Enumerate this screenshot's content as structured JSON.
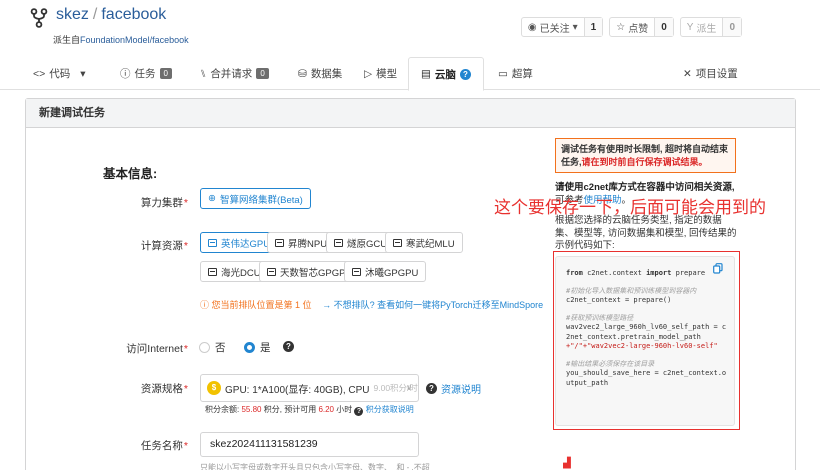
{
  "repo": {
    "owner": "skez",
    "separator": "/",
    "name": "facebook",
    "forked_prefix": "派生自",
    "forked_from": "FoundationModel/facebook",
    "buttons": [
      {
        "label": "已关注",
        "icon": "eye-icon",
        "caret": "▾",
        "count": "1"
      },
      {
        "label": "点赞",
        "icon": "star-icon",
        "count": "0"
      },
      {
        "label": "派生",
        "icon": "fork-icon",
        "count": "0",
        "disabled": true
      }
    ]
  },
  "tabs": [
    {
      "label": "代码",
      "icon": "code-icon",
      "caret": "▾"
    },
    {
      "label": "任务",
      "icon": "issue-icon",
      "badge": "0"
    },
    {
      "label": "合并请求",
      "icon": "pull-request-icon",
      "badge": "0"
    },
    {
      "label": "数据集",
      "icon": "dataset-icon"
    },
    {
      "label": "模型",
      "icon": "model-icon"
    },
    {
      "label": "云脑",
      "icon": "cloudbrain-icon",
      "active": true,
      "help": "?"
    },
    {
      "label": "超算",
      "icon": "supercompute-icon"
    },
    {
      "label": "项目设置",
      "icon": "settings-icon"
    }
  ],
  "panel": {
    "title": "新建调试任务",
    "section_title": "基本信息:",
    "compute_cluster": {
      "label": "算力集群",
      "required": "*",
      "option": "智算网络集群(Beta)"
    },
    "compute_resource": {
      "label": "计算资源",
      "required": "*",
      "options": [
        "英伟达GPU",
        "昇腾NPU",
        "燧原GCU",
        "寒武纪MLU",
        "海光DCU",
        "天数智芯GPGPU",
        "沐曦GPGPU"
      ],
      "selected": "英伟达GPU"
    },
    "queue_notice": "您当前排队位置是第 1 位",
    "queue_link": "→ 不想排队? 查看如何一键将PyTorch迁移至MindSpore",
    "internet": {
      "label": "访问Internet",
      "required": "*",
      "options": [
        "否",
        "是"
      ],
      "selected": "是",
      "help": "?"
    },
    "spec": {
      "label": "资源规格",
      "required": "*",
      "coin": "$",
      "value": "GPU: 1*A100(显存: 40GB), CPU",
      "price": "9.00积分/时",
      "caret": "∨",
      "help": "?",
      "help_link": "资源说明"
    },
    "points": {
      "balance_label": "积分余额:",
      "balance": "55.80",
      "unit": "积分,",
      "usable_label": "预计可用",
      "usable": "6.20",
      "usable_unit": "小时",
      "help": "?",
      "link": "积分获取说明"
    },
    "task_name": {
      "label": "任务名称",
      "required": "*",
      "value": "skez202411131581239"
    },
    "task_name_hint": "只能以小写字母或数字开头且只包含小写字母、数字、_和 - ,不超"
  },
  "sidebar": {
    "warning_text": "调试任务有使用时长限制, 超时将自动结束任务,",
    "warning_red": "请在到时前自行保存调试结果。",
    "guide_bold": "请使用c2net库方式在容器中访问相关资源,",
    "guide_prefix": "可参考",
    "guide_link": "使用帮助",
    "guide_suffix": "。",
    "guide_body": "根据您选择的云脑任务类型, 指定的数据集、模型等, 访问数据集和模型, 回传结果的示例代码如下:",
    "code": {
      "import_from": "from",
      "import_module": " c2net.context ",
      "import_kw": "import",
      "import_name": " prepare",
      "comment1": "#初始化导入数据集和预训练模型到容器内",
      "line1": "c2net_context = prepare()",
      "comment2": "#获取预训练模型路径",
      "line2a": "wav2vec2_large_960h_lv60_self_path = c",
      "line2b": "2net_context.pretrain_model_path",
      "line2c": "+\"/\"+\"wav2vec2-large-960h-lv60-self\"",
      "comment3": "#输出结果必须保存在该目录",
      "line3a": "you_should_save_here = c2net_context.o",
      "line3b": "utput_path"
    }
  },
  "annotation": {
    "text": "这个要保存一下，后面可能会用到的",
    "color": "#e8312f"
  },
  "colors": {
    "primary": "#2185d0",
    "warning": "#f2711c",
    "danger": "#db2828",
    "repo_link": "#2a5d9a"
  }
}
